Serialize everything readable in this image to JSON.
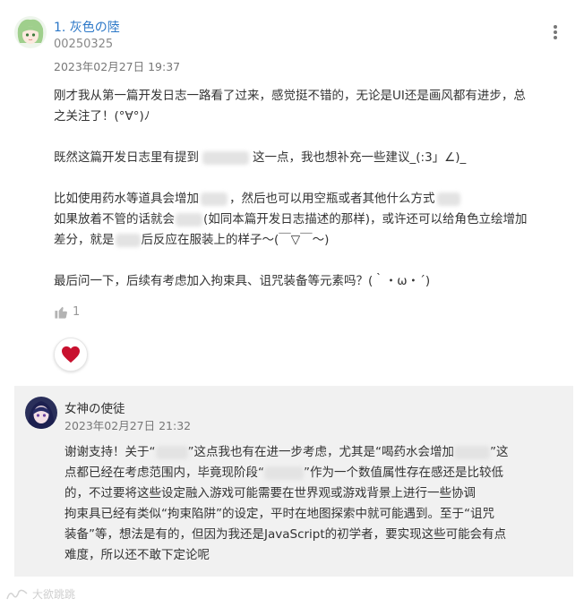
{
  "comment": {
    "index_name": "1. 灰色の陸",
    "user_id": "00250325",
    "timestamp": "2023年02月27日 19:37",
    "paragraphs": [
      [
        "刚才我从第一篇开发日志一路看了过来，感觉挺不错的，无论是UI还是画风都有进步，总",
        "之关注了！(°∀°)ﾉ"
      ],
      [
        "既然这篇开发日志里有提到",
        "这一点，我也想补充一些建议_(:3」∠)_"
      ],
      [
        "比如使用药水等道具会增加",
        "，然后也可以用空瓶或者其他什么方式",
        "如果放着不管的话就会",
        "(如同本篇开发日志描述的那样)，或许还可以给角色立绘增加",
        "差分，就是",
        "后反应在服装上的样子～(￣▽￣～)"
      ],
      [
        "最后问一下，后续有考虑加入拘束具、诅咒装备等元素吗？(｀・ω・´)"
      ]
    ],
    "likes": "1",
    "more_icon": "more-vertical-icon",
    "like_icon": "thumbs-up-icon",
    "reaction_icon": "heart-icon",
    "heart_color": "#c8102e"
  },
  "reply": {
    "author": "女神の使徒",
    "timestamp": "2023年02月27日 21:32",
    "line1_a": "谢谢支持！关于“",
    "line1_b": "”这点我也有在进一步考虑，尤其是“喝药水会增加",
    "line1_c": "”这",
    "line2": "点都已经在考虑范围内，毕竟现阶段“",
    "line2_b": "”作为一个数值属性存在感还是比较低",
    "line3": "的，不过要将这些设定融入游戏可能需要在世界观或游戏背景上进行一些协调",
    "line4": "拘束具已经有类似“拘束陷阱”的设定，平时在地图探索中就可能遇到。至于“诅咒",
    "line5": "装备”等，想法是有的，但因为我还是JavaScript的初学者，要实现这些可能会有点",
    "line6": "难度，所以还不敢下定论呢"
  },
  "watermark": "大欲跳跳"
}
